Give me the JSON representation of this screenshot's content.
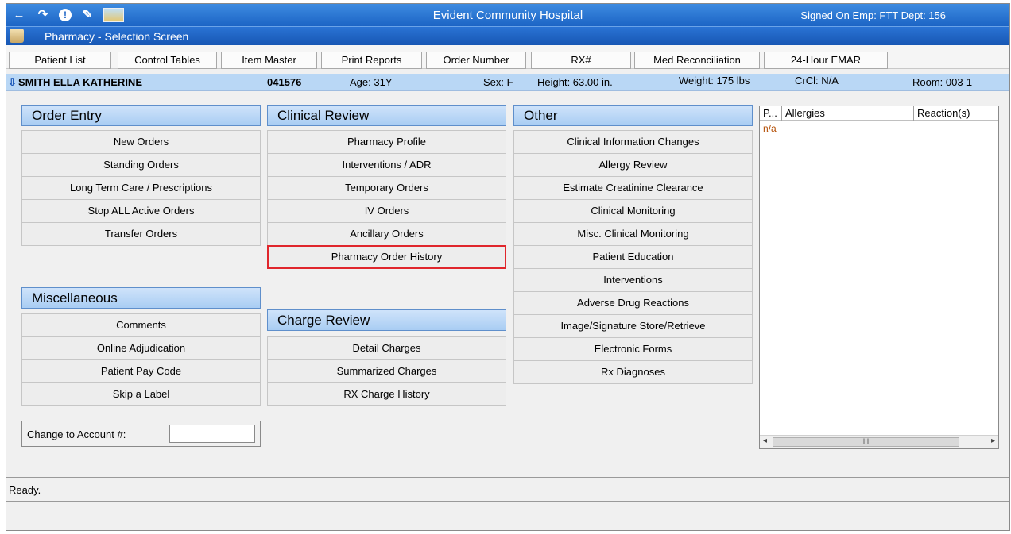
{
  "window": {
    "title": "Evident Community Hospital",
    "signed_on": "Signed On Emp: FTT  Dept: 156",
    "subtitle": "Pharmacy - Selection Screen"
  },
  "toolbar_icons": [
    "back-arrow-icon",
    "forward-arrow-icon",
    "info-icon",
    "pencil-icon",
    "picture-icon"
  ],
  "toolbar": {
    "buttons": [
      {
        "label": "Patient List"
      },
      {
        "label": "Control Tables"
      },
      {
        "label": "Item Master"
      },
      {
        "label": "Print Reports"
      },
      {
        "label": "Order Number"
      },
      {
        "label": "RX#"
      },
      {
        "label": "Med Reconciliation"
      },
      {
        "label": "24-Hour EMAR"
      }
    ]
  },
  "patient": {
    "name": "SMITH ELLA KATHERINE",
    "mrn": "041576",
    "age": "Age:    31Y",
    "sex": "Sex: F",
    "height": "Height: 63.00 in.",
    "weight": "Weight: 175 lbs",
    "crcl": "CrCl:   N/A",
    "room": "Room: 003-1"
  },
  "sections": {
    "order_entry": {
      "title": "Order Entry",
      "items": [
        "New Orders",
        "Standing Orders",
        "Long Term Care / Prescriptions",
        "Stop ALL Active Orders",
        "Transfer Orders"
      ]
    },
    "miscellaneous": {
      "title": "Miscellaneous",
      "items": [
        "Comments",
        "Online Adjudication",
        "Patient Pay Code",
        "Skip a Label"
      ]
    },
    "clinical_review": {
      "title": "Clinical Review",
      "items": [
        "Pharmacy Profile",
        "Interventions / ADR",
        "Temporary Orders",
        "IV Orders",
        "Ancillary Orders",
        "Pharmacy Order History"
      ],
      "selected": "Pharmacy Order History"
    },
    "charge_review": {
      "title": "Charge Review",
      "items": [
        "Detail Charges",
        "Summarized Charges",
        "RX Charge History"
      ]
    },
    "other": {
      "title": "Other",
      "items": [
        "Clinical Information Changes",
        "Allergy Review",
        "Estimate Creatinine Clearance",
        "Clinical Monitoring",
        "Misc. Clinical Monitoring",
        "Patient Education",
        "Interventions",
        "Adverse Drug Reactions",
        "Image/Signature Store/Retrieve",
        "Electronic Forms",
        "Rx Diagnoses"
      ]
    }
  },
  "account": {
    "label": "Change to Account #:",
    "value": ""
  },
  "allergies": {
    "columns": [
      "P...",
      "Allergies",
      "Reaction(s)"
    ],
    "rows": [
      [
        "n/a",
        "",
        ""
      ]
    ],
    "scroll_thumb": "III"
  },
  "status": "Ready.",
  "colors": {
    "titlebar": "#1c64c5",
    "patient_bar": "#b9d7f5",
    "section_header": "#a9cdf3",
    "selected_border": "#e0262c",
    "allergy_text": "#b24b00"
  }
}
